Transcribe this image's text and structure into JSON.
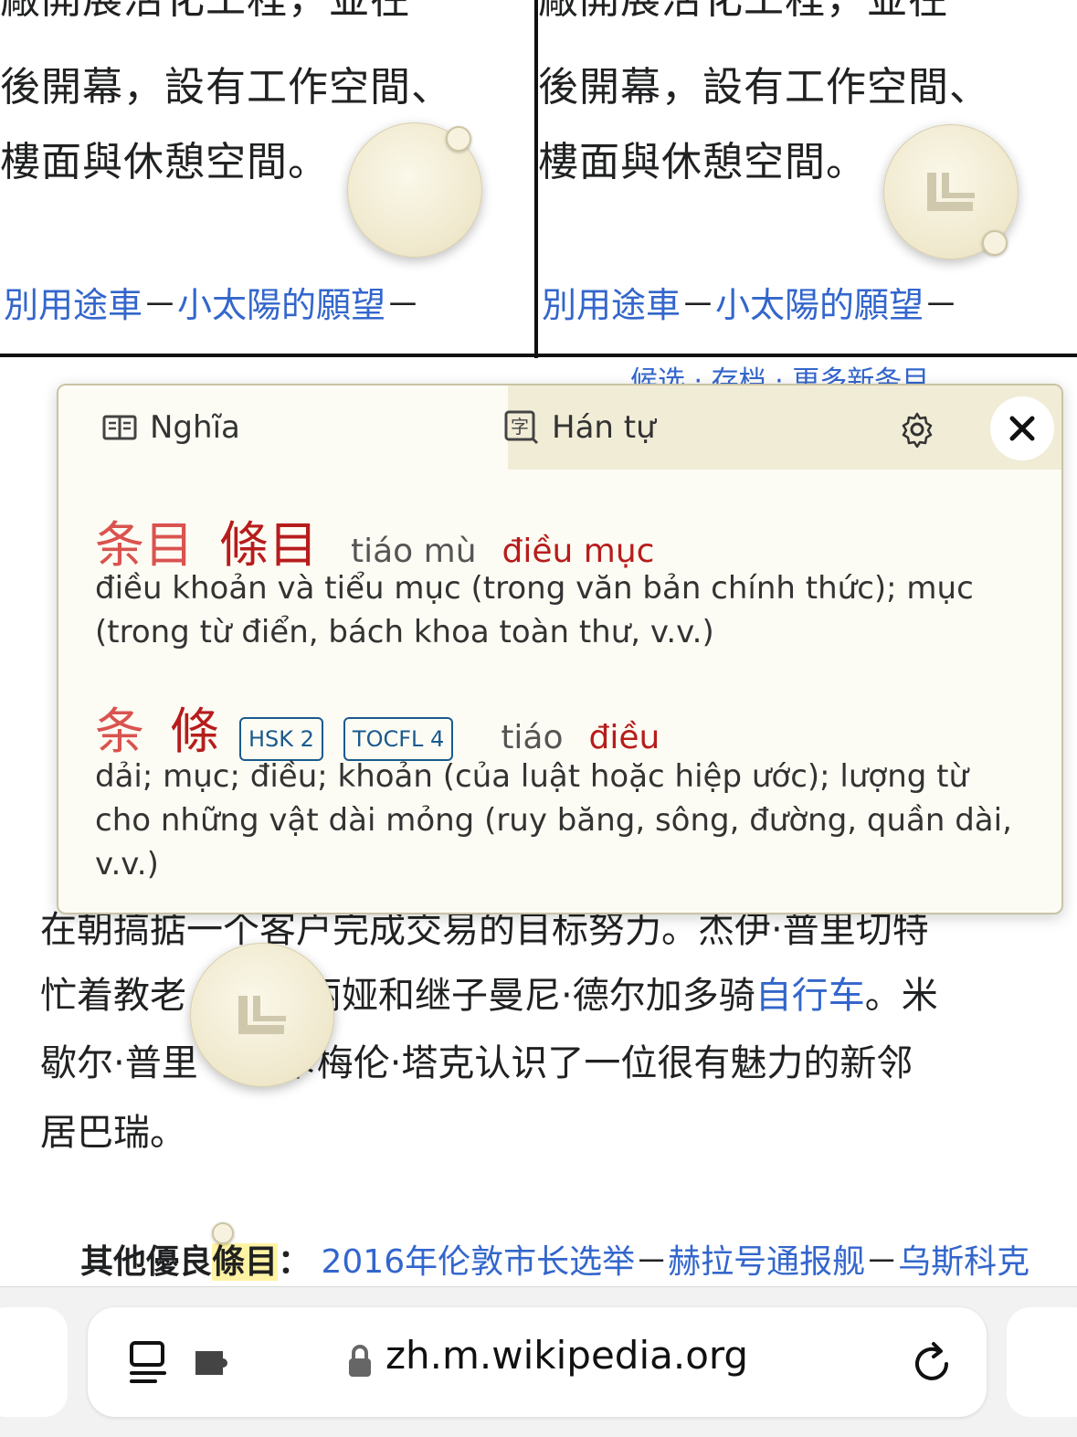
{
  "top_panels": {
    "line0": "廠開展活化工程，並在",
    "line1": "後開幕，設有工作空間、",
    "line2": "樓面與休憩空間。",
    "link1": "別用途車",
    "sep": "－",
    "link2": "小太陽的願望"
  },
  "candidates_bar": "候选 · 存档 · 更多新条目",
  "popup": {
    "tab_meaning": "Nghĩa",
    "tab_hanzi": "Hán tự",
    "entries": [
      {
        "simplified": "条目",
        "traditional": "條目",
        "pinyin": "tiáo mù",
        "vietnamese": "điều mục",
        "definition": "điều khoản và tiểu mục (trong văn bản chính thức); mục (trong từ điển, bách khoa toàn thư, v.v.)"
      },
      {
        "simplified": "条",
        "traditional": "條",
        "badges": [
          "HSK 2",
          "TOCFL 4"
        ],
        "pinyin": "tiáo",
        "vietnamese": "điều",
        "definition": "dải; mục; điều; khoản (của luật hoặc hiệp ước); lượng từ cho những vật dài mỏng (ruy băng, sông, đường, quần dài, v.v.)"
      }
    ]
  },
  "article": {
    "line1": "在朝搞掂一个客户完成交易的目标努力。杰伊·普里切特",
    "line2_pre": "忙着教老",
    "line2_mid": "丽娅和继子曼尼·德尔加多骑",
    "line2_link": "自行车",
    "line2_post": "。米",
    "line3_pre": "歇尔·普里",
    "line3_post": "和卡梅伦·塔克认识了一位很有魅力的新邻",
    "line4": "居巴瑞。"
  },
  "bottom_links": {
    "label": "其他優良",
    "highlight": "條目",
    "colon": "：",
    "link1": "2016年伦敦市长选举",
    "sep": "－",
    "link2": "赫拉号通报舰",
    "link3": "乌斯科克"
  },
  "browser": {
    "url": "zh.m.wikipedia.org"
  },
  "colors": {
    "link": "#3366cc",
    "hanzi_red": "#b71c1c",
    "popup_bg": "#fdfcf4",
    "badge": "#1a5a8e"
  }
}
